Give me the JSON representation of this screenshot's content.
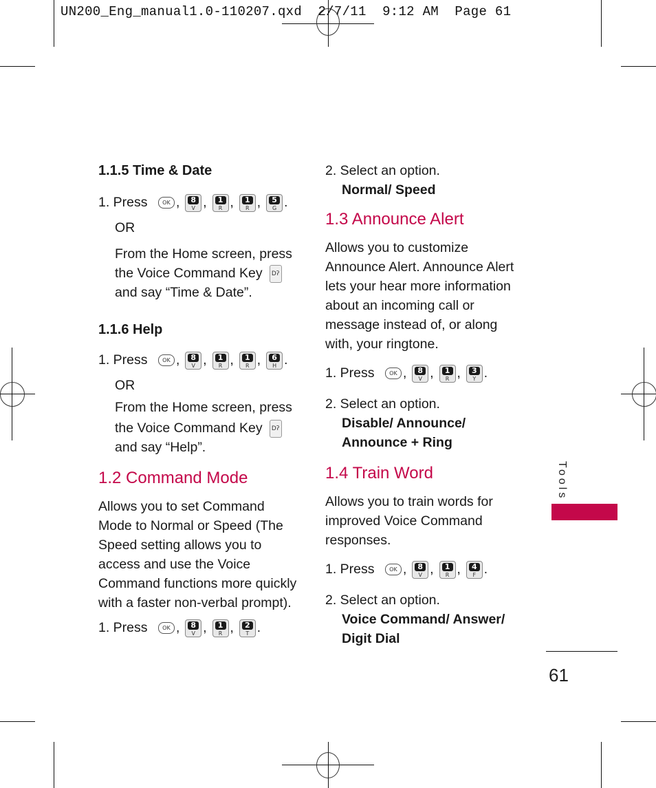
{
  "slug": "UN200_Eng_manual1.0-110207.qxd  2/7/11  9:12 AM  Page 61",
  "colors": {
    "accent": "#c4084a"
  },
  "left_column": {
    "s115": {
      "heading": "1.1.5 Time & Date",
      "step1_prefix": "1. Press",
      "keys": [
        {
          "type": "ok",
          "label": "OK"
        },
        {
          "type": "key",
          "num": "8",
          "letter": "V"
        },
        {
          "type": "key",
          "num": "1",
          "letter": "R"
        },
        {
          "type": "key",
          "num": "1",
          "letter": "R"
        },
        {
          "type": "key",
          "num": "5",
          "letter": "G"
        }
      ],
      "or": "OR",
      "alt_line1": "From the Home screen, press",
      "alt_line2": "the Voice Command Key",
      "alt_line3": "and say “Time & Date”."
    },
    "s116": {
      "heading": "1.1.6 Help",
      "step1_prefix": "1. Press",
      "keys": [
        {
          "type": "ok",
          "label": "OK"
        },
        {
          "type": "key",
          "num": "8",
          "letter": "V"
        },
        {
          "type": "key",
          "num": "1",
          "letter": "R"
        },
        {
          "type": "key",
          "num": "1",
          "letter": "R"
        },
        {
          "type": "key",
          "num": "6",
          "letter": "H"
        }
      ],
      "or": "OR",
      "alt_line1": "From the Home screen, press",
      "alt_line2": "the Voice Command Key",
      "alt_line3": "and say “Help”."
    },
    "s12": {
      "heading": "1.2 Command Mode",
      "body": [
        "Allows you to set Command",
        "Mode to Normal or Speed (The",
        "Speed setting allows you to",
        "access and use the Voice",
        "Command functions more quickly",
        "with a faster non-verbal prompt)."
      ],
      "step1_prefix": "1. Press",
      "keys": [
        {
          "type": "ok",
          "label": "OK"
        },
        {
          "type": "key",
          "num": "8",
          "letter": "V"
        },
        {
          "type": "key",
          "num": "1",
          "letter": "R"
        },
        {
          "type": "key",
          "num": "2",
          "letter": "T"
        }
      ]
    }
  },
  "right_column": {
    "s12_cont": {
      "step2": "2. Select an option.",
      "options": "Normal/ Speed"
    },
    "s13": {
      "heading": "1.3 Announce Alert",
      "body": [
        "Allows you to customize",
        "Announce Alert. Announce Alert",
        "lets your hear more information",
        "about an incoming call or",
        "message instead of, or along",
        "with, your ringtone."
      ],
      "step1_prefix": "1. Press",
      "keys": [
        {
          "type": "ok",
          "label": "OK"
        },
        {
          "type": "key",
          "num": "8",
          "letter": "V"
        },
        {
          "type": "key",
          "num": "1",
          "letter": "R"
        },
        {
          "type": "key",
          "num": "3",
          "letter": "Y"
        }
      ],
      "step2": "2. Select an option.",
      "options": [
        "Disable/ Announce/",
        "Announce + Ring"
      ]
    },
    "s14": {
      "heading": "1.4 Train Word",
      "body": [
        "Allows you to train words for",
        "improved Voice Command",
        "responses."
      ],
      "step1_prefix": "1. Press",
      "keys": [
        {
          "type": "ok",
          "label": "OK"
        },
        {
          "type": "key",
          "num": "8",
          "letter": "V"
        },
        {
          "type": "key",
          "num": "1",
          "letter": "R"
        },
        {
          "type": "key",
          "num": "4",
          "letter": "F"
        }
      ],
      "step2": "2. Select an option.",
      "options": [
        "Voice Command/ Answer/",
        "Digit Dial"
      ]
    }
  },
  "sidebar": {
    "tab_label": "Tools",
    "page_number": "61"
  },
  "icons": {
    "ok_key": "ok-key-icon",
    "voice_key": "voice-command-key-icon",
    "voice_key_glyph": "Dʔ"
  }
}
